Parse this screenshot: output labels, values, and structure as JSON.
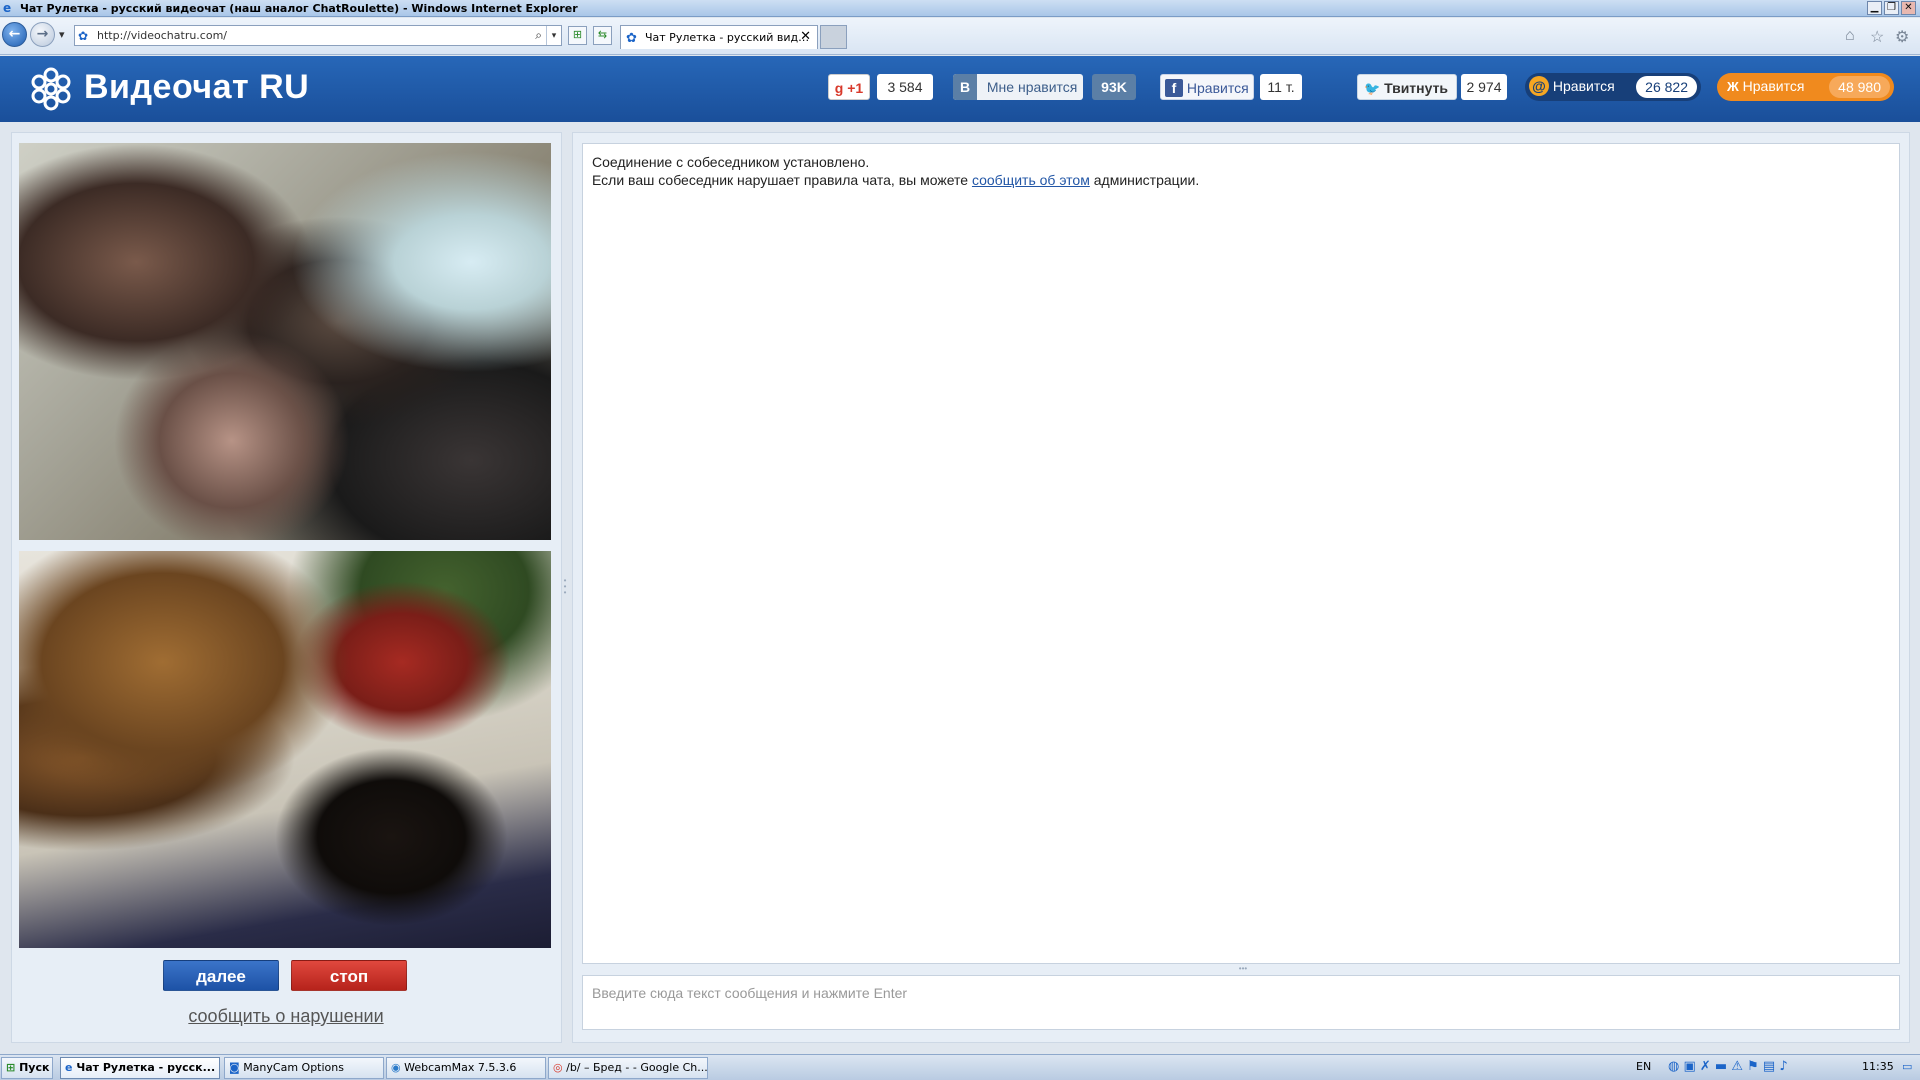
{
  "window": {
    "title": "Чат Рулетка - русский видеочат (наш аналог ChatRoulette) - Windows Internet Explorer",
    "min": "▁",
    "max": "❐",
    "close": "✕"
  },
  "browser": {
    "back": "←",
    "forward": "→",
    "history_dropdown": "▾",
    "url": "http://videochatru.com/",
    "search_icon": "⌕",
    "addr_dropdown": "▾",
    "compat_icon": "⊞",
    "refresh_icon": "⇆",
    "tab_label": "Чат Рулетка - русский вид…",
    "tab_close": "✕",
    "home_icon": "⌂",
    "favorites_icon": "☆",
    "tools_icon": "⚙"
  },
  "header": {
    "logo_text": "Видеочат RU",
    "social": {
      "gplus_label": "+1",
      "gplus_icon": "g",
      "gplus_count": "3 584",
      "vk_icon": "В",
      "vk_label": "Мне нравится",
      "vk_count": "93K",
      "fb_icon": "f",
      "fb_label": "Нравится",
      "fb_count": "11 т.",
      "tw_icon": "🐦",
      "tw_label": "Твитнуть",
      "tw_count": "2 974",
      "mail_icon": "@",
      "mail_label": "Нравится",
      "mail_count": "26 822",
      "ok_icon": "Ж",
      "ok_label": "Нравится",
      "ok_count": "48 980"
    }
  },
  "controls": {
    "next_label": "далее",
    "stop_label": "стоп",
    "report_label": "сообщить о нарушении"
  },
  "chat": {
    "line1": "Соединение с собеседником установлено.",
    "line2_pre": "Если ваш собеседник нарушает правила чата, вы можете ",
    "line2_link": "сообщить об этом",
    "line2_post": " администрации.",
    "input_placeholder": "Введите сюда текст сообщения и нажмите Enter"
  },
  "taskbar": {
    "start": "Пуск",
    "items": [
      "Чат Рулетка - русск...",
      "ManyCam Options",
      "WebcamMax  7.5.3.6",
      "/b/ – Бред - - Google Ch..."
    ],
    "lang": "EN",
    "clock": "11:35"
  },
  "colors": {
    "banner": "#1f5aa8",
    "next_button": "#2a62b8",
    "stop_button": "#cc3128",
    "ok_orange": "#f08a1e",
    "mail_dark": "#173f79"
  }
}
